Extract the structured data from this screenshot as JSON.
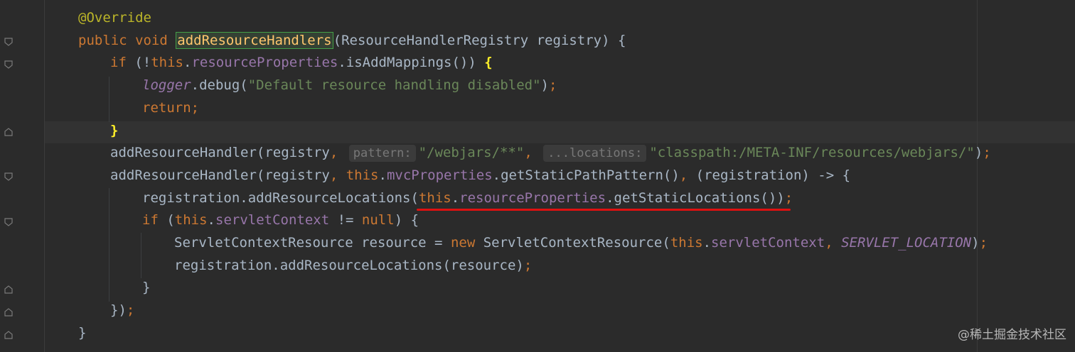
{
  "editor": {
    "lines": [
      [
        {
          "c": "ann",
          "t": "@Override"
        }
      ],
      [
        {
          "c": "kw",
          "t": "public void "
        },
        {
          "c": "method-hl",
          "t": "addResourceHandlers"
        },
        {
          "c": "plain",
          "t": "(ResourceHandlerRegistry registry) {"
        }
      ],
      [
        {
          "c": "kw",
          "t": "if "
        },
        {
          "c": "plain",
          "t": "(!"
        },
        {
          "c": "kw",
          "t": "this"
        },
        {
          "c": "plain",
          "t": "."
        },
        {
          "c": "fld",
          "t": "resourceProperties"
        },
        {
          "c": "plain",
          "t": ".isAddMappings()) "
        },
        {
          "c": "brace-hl",
          "t": "{"
        }
      ],
      [
        {
          "c": "ifld",
          "t": "logger"
        },
        {
          "c": "plain",
          "t": ".debug("
        },
        {
          "c": "str",
          "t": "\"Default resource handling disabled\""
        },
        {
          "c": "plain",
          "t": ")"
        },
        {
          "c": "kw",
          "t": ";"
        }
      ],
      [
        {
          "c": "kw",
          "t": "return;"
        }
      ],
      [
        {
          "c": "brace-hl",
          "t": "}"
        }
      ],
      [
        {
          "c": "plain",
          "t": "addResourceHandler(registry"
        },
        {
          "c": "kw",
          "t": ", "
        },
        {
          "c": "hint",
          "t": "pattern:"
        },
        {
          "c": "str",
          "t": "\"/webjars/**\""
        },
        {
          "c": "kw",
          "t": ", "
        },
        {
          "c": "hint",
          "t": "...locations:"
        },
        {
          "c": "str",
          "t": "\"classpath:/META-INF/resources/webjars/\""
        },
        {
          "c": "plain",
          "t": ")"
        },
        {
          "c": "kw",
          "t": ";"
        }
      ],
      [
        {
          "c": "plain",
          "t": "addResourceHandler(registry"
        },
        {
          "c": "kw",
          "t": ", this"
        },
        {
          "c": "plain",
          "t": "."
        },
        {
          "c": "fld",
          "t": "mvcProperties"
        },
        {
          "c": "plain",
          "t": ".getStaticPathPattern()"
        },
        {
          "c": "kw",
          "t": ", "
        },
        {
          "c": "plain",
          "t": "(registration) -> {"
        }
      ],
      [
        {
          "c": "plain",
          "t": "registration.addResourceLocations("
        },
        {
          "c": "kw",
          "t": "this"
        },
        {
          "c": "plain",
          "t": "."
        },
        {
          "c": "fld",
          "t": "resourceProperties"
        },
        {
          "c": "plain",
          "t": ".getStaticLocations())"
        },
        {
          "c": "kw",
          "t": ";"
        }
      ],
      [
        {
          "c": "kw",
          "t": "if "
        },
        {
          "c": "plain",
          "t": "("
        },
        {
          "c": "kw",
          "t": "this"
        },
        {
          "c": "plain",
          "t": "."
        },
        {
          "c": "fld",
          "t": "servletContext "
        },
        {
          "c": "plain",
          "t": "!= "
        },
        {
          "c": "kw",
          "t": "null"
        },
        {
          "c": "plain",
          "t": ") {"
        }
      ],
      [
        {
          "c": "plain",
          "t": "ServletContextResource resource = "
        },
        {
          "c": "kw",
          "t": "new "
        },
        {
          "c": "plain",
          "t": "ServletContextResource("
        },
        {
          "c": "kw",
          "t": "this"
        },
        {
          "c": "plain",
          "t": "."
        },
        {
          "c": "fld",
          "t": "servletContext"
        },
        {
          "c": "kw",
          "t": ", "
        },
        {
          "c": "ifld",
          "t": "SERVLET_LOCATION"
        },
        {
          "c": "plain",
          "t": ")"
        },
        {
          "c": "kw",
          "t": ";"
        }
      ],
      [
        {
          "c": "plain",
          "t": "registration.addResourceLocations(resource)"
        },
        {
          "c": "kw",
          "t": ";"
        }
      ],
      [
        {
          "c": "plain",
          "t": "}"
        }
      ],
      [
        {
          "c": "plain",
          "t": "})"
        },
        {
          "c": "kw",
          "t": ";"
        }
      ],
      [
        {
          "c": "plain",
          "t": "}"
        }
      ]
    ],
    "indents": [
      1,
      1,
      2,
      3,
      3,
      2,
      2,
      2,
      3,
      3,
      4,
      4,
      3,
      2,
      1
    ]
  },
  "watermark": "@稀土掘金技术社区"
}
